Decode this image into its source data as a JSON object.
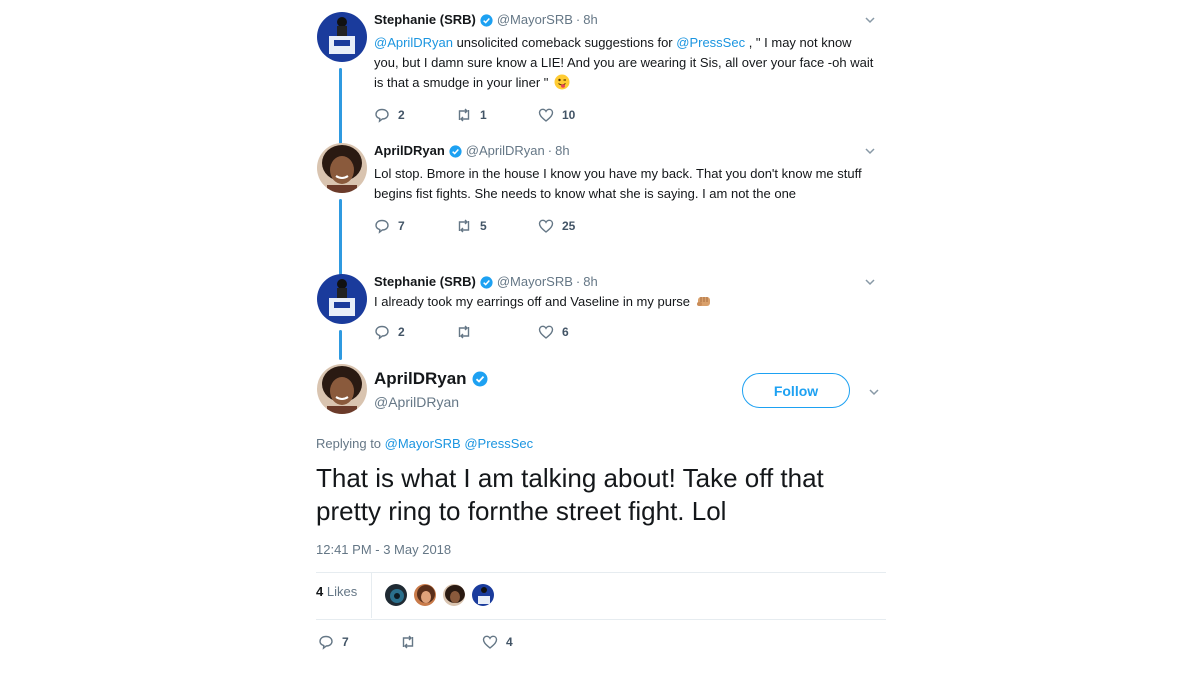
{
  "tweets": [
    {
      "name": "Stephanie (SRB)",
      "handle": "@MayorSRB",
      "time": "8h",
      "mention1": "@AprilDRyan",
      "text1": " unsolicited comeback suggestions for ",
      "mention2": "@PressSec",
      "text2": " , \" I may not know you, but I damn sure know a LIE!  And you are wearing it Sis, all over your face -oh wait is that a smudge in your liner \"",
      "replies": "2",
      "retweets": "1",
      "likes": "10",
      "emoji": "winking-tongue-emoji"
    },
    {
      "name": "AprilDRyan",
      "handle": "@AprilDRyan",
      "time": "8h",
      "text": "Lol stop. Bmore in the house I know you have my back.  That you don't know me stuff begins fist fights. She needs to know what she is saying.   I am not the one",
      "replies": "7",
      "retweets": "5",
      "likes": "25"
    },
    {
      "name": "Stephanie (SRB)",
      "handle": "@MayorSRB",
      "time": "8h",
      "text": "I already took my earrings off and Vaseline in my purse",
      "replies": "2",
      "retweets": "",
      "likes": "6",
      "emoji": "fist-emoji"
    }
  ],
  "focus": {
    "name": "AprilDRyan",
    "handle": "@AprilDRyan",
    "follow_label": "Follow",
    "replying_prefix": "Replying to ",
    "replying_to": [
      "@MayorSRB",
      "@PressSec"
    ],
    "text": "That is what I am talking about!  Take off that pretty ring to fornthe street fight. Lol",
    "timestamp": "12:41 PM - 3 May 2018",
    "likes_count": "4",
    "likes_label": " Likes",
    "replies": "7",
    "retweets": "",
    "likes": "4"
  },
  "separator": "·",
  "colors": {
    "link": "#1b95e0",
    "verified": "#1da1f2",
    "thread_line": "#2f9ae0",
    "muted": "#657786"
  }
}
